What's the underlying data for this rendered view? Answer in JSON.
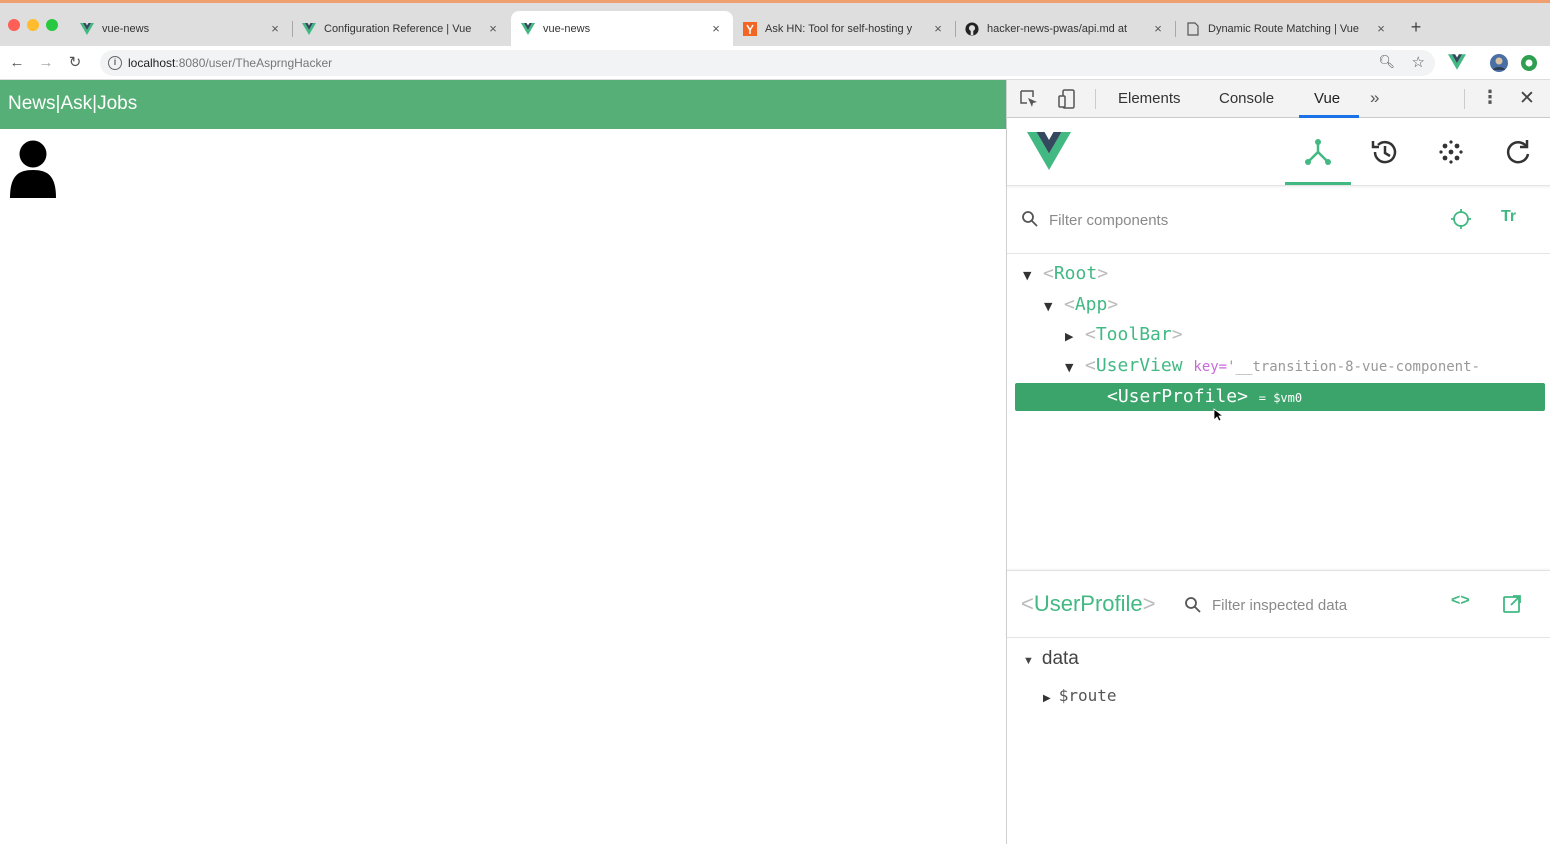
{
  "browser": {
    "tabs": [
      {
        "label": "vue-news",
        "favicon": "vue-logo-icon",
        "active": false
      },
      {
        "label": "Configuration Reference | Vue",
        "favicon": "vue-logo-icon",
        "active": false
      },
      {
        "label": "vue-news",
        "favicon": "vue-logo-icon",
        "active": true
      },
      {
        "label": "Ask HN: Tool for self-hosting y",
        "favicon": "hn-icon",
        "active": false
      },
      {
        "label": "hacker-news-pwas/api.md at",
        "favicon": "github-icon",
        "active": false
      },
      {
        "label": "Dynamic Route Matching | Vue",
        "favicon": "page-icon",
        "active": false
      }
    ],
    "close_glyph": "×",
    "new_tab_glyph": "+",
    "url_host": "localhost",
    "url_rest": ":8080/user/TheAsprngHacker"
  },
  "page": {
    "toolbar_links": [
      "News",
      "|",
      "Ask",
      "|",
      "Jobs"
    ]
  },
  "devtools": {
    "tabs": [
      "Elements",
      "Console",
      "Vue"
    ],
    "active_tab": "Vue",
    "more_glyph": "»",
    "vue_panel": {
      "filter_placeholder": "Filter components",
      "tt_label": "Tr",
      "tree": [
        {
          "name": "Root",
          "depth": 0,
          "expanded": true
        },
        {
          "name": "App",
          "depth": 1,
          "expanded": true
        },
        {
          "name": "ToolBar",
          "depth": 2,
          "expanded": false
        },
        {
          "name": "UserView",
          "depth": 2,
          "expanded": true,
          "key_attr": "key=",
          "key_value": "'__transition-8-vue-component-"
        },
        {
          "name": "UserProfile",
          "depth": 3,
          "selected": true,
          "vm": "= $vm0"
        }
      ],
      "inspector": {
        "component": "UserProfile",
        "filter_placeholder": "Filter inspected data",
        "code_glyph": "<>",
        "section": "data",
        "props": [
          "$route"
        ]
      }
    }
  },
  "colors": {
    "vue_green": "#42b983",
    "toolbar_green": "#55af76",
    "selected_green": "#3ba46a"
  }
}
